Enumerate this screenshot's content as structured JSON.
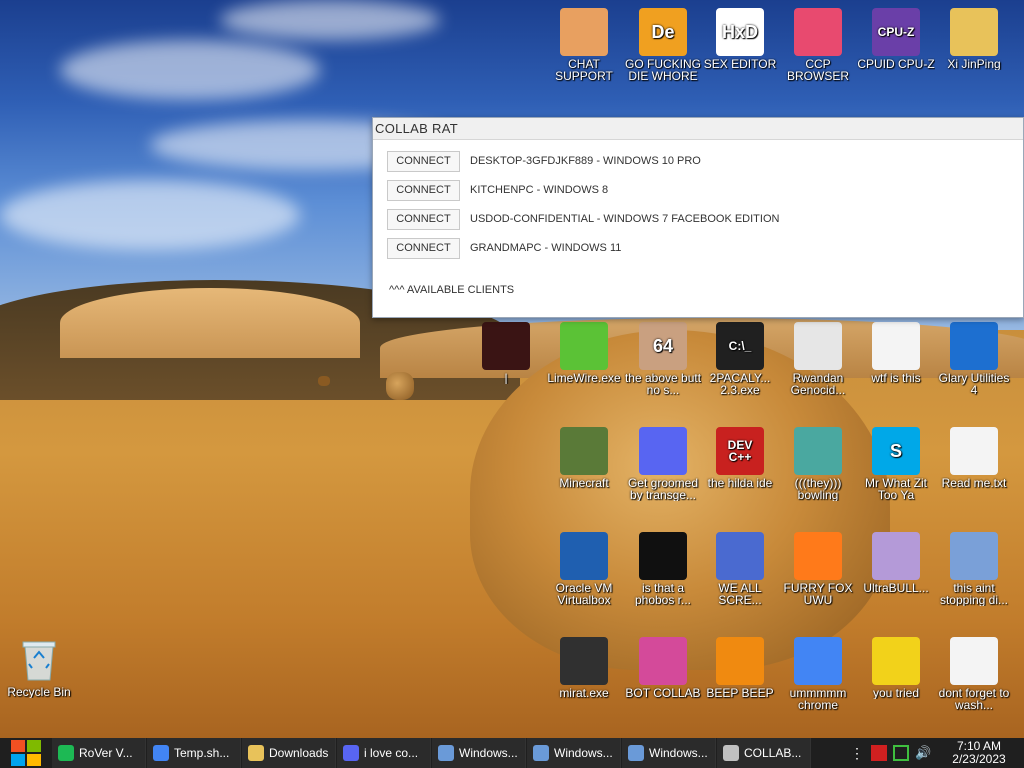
{
  "desktop": {
    "top_row": [
      {
        "label": "CHAT SUPPORT",
        "icon": "support-agent-icon",
        "color": "#e8a060"
      },
      {
        "label": "GO FUCKING DIE WHORE",
        "icon": "de-logo-icon",
        "glyph": "De",
        "color": "#f0a020"
      },
      {
        "label": "SEX EDITOR",
        "icon": "hxd-icon",
        "glyph": "HxD",
        "color": "#ffffff"
      },
      {
        "label": "CCP BROWSER",
        "icon": "colorful-flower-icon",
        "color": "#e84a6f"
      },
      {
        "label": "CPUID CPU-Z",
        "icon": "cpuz-icon",
        "glyph": "CPU-Z",
        "color": "#6a3fa8"
      },
      {
        "label": "Xi JinPing",
        "icon": "folder-user-icon",
        "color": "#e8c25a"
      }
    ],
    "grid": [
      {
        "label": "|",
        "icon": "dark-image-icon",
        "color": "#3a1414"
      },
      {
        "label": "LimeWire.exe",
        "icon": "limewire-icon",
        "color": "#5bc236"
      },
      {
        "label": "the above butt no s...",
        "icon": "portrait-icon",
        "glyph": "64",
        "color": "#c9a080"
      },
      {
        "label": "2PACALY... 2.3.exe",
        "icon": "terminal-icon",
        "glyph": "C:\\_",
        "color": "#202020"
      },
      {
        "label": "Rwandan Genocid...",
        "icon": "meme-face-icon",
        "color": "#e6e6e6"
      },
      {
        "label": "wtf is this",
        "icon": "document-grid-icon",
        "color": "#f4f4f4"
      },
      {
        "label": "Glary Utilities 4",
        "icon": "glary-moon-icon",
        "color": "#1d6fd0"
      },
      {
        "label": "Minecraft",
        "icon": "minecraft-block-icon",
        "color": "#5a7a38"
      },
      {
        "label": "Get groomed by transge...",
        "icon": "discord-icon",
        "color": "#5865f2"
      },
      {
        "label": "the hilda ide",
        "icon": "devcpp-icon",
        "glyph": "DEV C++",
        "color": "#c8211f"
      },
      {
        "label": "(((they))) bowling",
        "icon": "cartoon-face-icon",
        "color": "#4aa8a0"
      },
      {
        "label": "Mr What Zit Too Ya",
        "icon": "skype-icon",
        "glyph": "S",
        "color": "#00a8e8"
      },
      {
        "label": "Read me.txt",
        "icon": "text-file-icon",
        "color": "#f4f4f4"
      },
      {
        "label": "Oracle VM Virtualbox",
        "icon": "virtualbox-icon",
        "color": "#1f5fb0"
      },
      {
        "label": "is that a phobos r...",
        "icon": "green-flower-icon",
        "color": "#101010"
      },
      {
        "label": "WE ALL SCRE...",
        "icon": "old-computer-icon",
        "color": "#4a6ad0"
      },
      {
        "label": "FURRY FOX UWU",
        "icon": "firefox-icon",
        "color": "#ff7a1a"
      },
      {
        "label": "UltraBULL...",
        "icon": "disc-icon",
        "color": "#b49ad8"
      },
      {
        "label": "this aint stopping di...",
        "icon": "computer-setup-icon",
        "color": "#7aa0d8"
      },
      {
        "label": "mirat.exe",
        "icon": "skull-icon",
        "color": "#303030"
      },
      {
        "label": "BOT COLLAB",
        "icon": "monitor-pink-icon",
        "color": "#d44a9a"
      },
      {
        "label": "BEEP BEEP",
        "icon": "vlc-cone-icon",
        "color": "#f08a10"
      },
      {
        "label": "ummmmm chrome",
        "icon": "chrome-icon",
        "color": "#4285f4"
      },
      {
        "label": "you tried",
        "icon": "star-icon",
        "color": "#f2d21a"
      },
      {
        "label": "dont forget to wash...",
        "icon": "document-grid-icon",
        "color": "#f4f4f4"
      }
    ],
    "recycle_bin": {
      "label": "Recycle Bin",
      "icon": "recycle-bin-icon"
    }
  },
  "rat_window": {
    "title": "COLLAB RAT",
    "connect_label": "CONNECT",
    "clients": [
      "DESKTOP-3GFDJKF889 - WINDOWS 10 PRO",
      "KITCHENPC - WINDOWS 8",
      "USDOD-CONFIDENTIAL - WINDOWS 7 FACEBOOK EDITION",
      "GRANDMAPC - WINDOWS 11"
    ],
    "footer": "^^^ AVAILABLE CLIENTS"
  },
  "taskbar": {
    "start_icon": "windows-logo-icon",
    "tasks": [
      {
        "label": "RoVer V...",
        "icon": "green-app-icon",
        "color": "#1db954"
      },
      {
        "label": "Temp.sh...",
        "icon": "chrome-icon",
        "color": "#4285f4"
      },
      {
        "label": "Downloads",
        "icon": "folder-icon",
        "color": "#e8c25a"
      },
      {
        "label": "i love co...",
        "icon": "discord-icon",
        "color": "#5865f2"
      },
      {
        "label": "Windows...",
        "icon": "window-icon",
        "color": "#6a9ad8"
      },
      {
        "label": "Windows...",
        "icon": "window-icon",
        "color": "#6a9ad8"
      },
      {
        "label": "Windows...",
        "icon": "window-icon",
        "color": "#6a9ad8"
      },
      {
        "label": "COLLAB...",
        "icon": "skull-icon",
        "color": "#c0c0c0"
      }
    ],
    "clock_time": "7:10 AM",
    "clock_date": "2/23/2023"
  }
}
